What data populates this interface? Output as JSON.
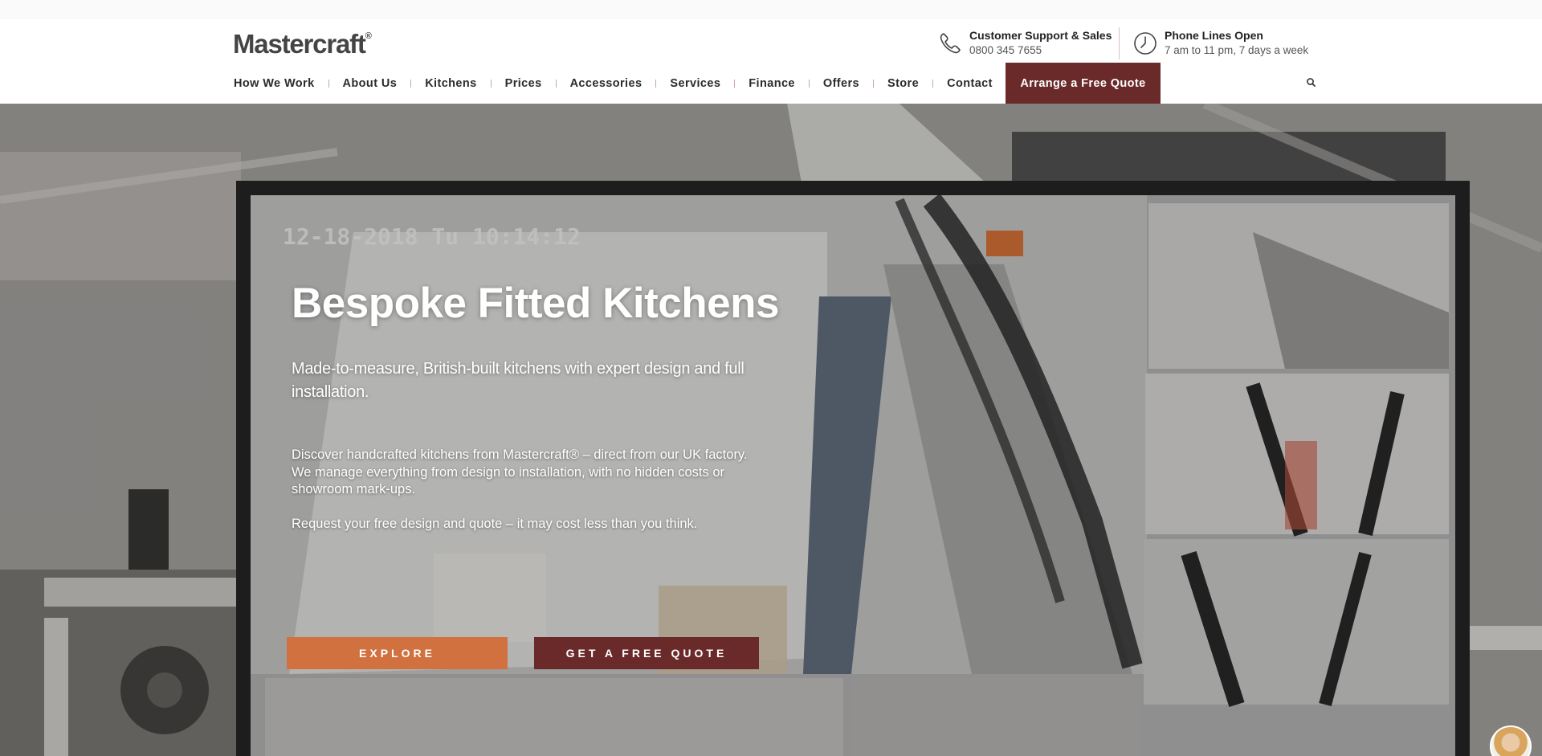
{
  "brand": {
    "logo_text": "Mastercraft",
    "logo_mark": "®"
  },
  "contact": {
    "support": {
      "icon": "phone-icon",
      "title": "Customer Support & Sales",
      "value": "0800 345 7655"
    },
    "hours": {
      "icon": "clock-icon",
      "title": "Phone Lines Open",
      "value": "7 am to 11 pm, 7 days a week"
    }
  },
  "nav": {
    "items": [
      {
        "label": "How We Work"
      },
      {
        "label": "About Us"
      },
      {
        "label": "Kitchens"
      },
      {
        "label": "Prices"
      },
      {
        "label": "Accessories"
      },
      {
        "label": "Services"
      },
      {
        "label": "Finance"
      },
      {
        "label": "Offers"
      },
      {
        "label": "Store"
      },
      {
        "label": "Contact"
      }
    ],
    "cta_label": "Arrange a Free Quote",
    "search_icon": "search-icon"
  },
  "hero": {
    "cctv_timestamp": "12-18-2018 Tu 10:14:12",
    "title": "Bespoke Fitted Kitchens",
    "lead": "Made-to-measure, British-built kitchens with expert design and full installation.",
    "body1": "Discover handcrafted kitchens from Mastercraft® – direct from our UK factory. We manage everything from design to installation, with no hidden costs or showroom mark-ups.",
    "body2": "Request your free design and quote – it may cost less than you think.",
    "explore_label": "EXPLORE",
    "quote_label": "GET A FREE QUOTE"
  },
  "colors": {
    "brand_maroon": "#6b2a2a",
    "accent_orange": "#d27140",
    "text_dark": "#2b2b2b"
  }
}
